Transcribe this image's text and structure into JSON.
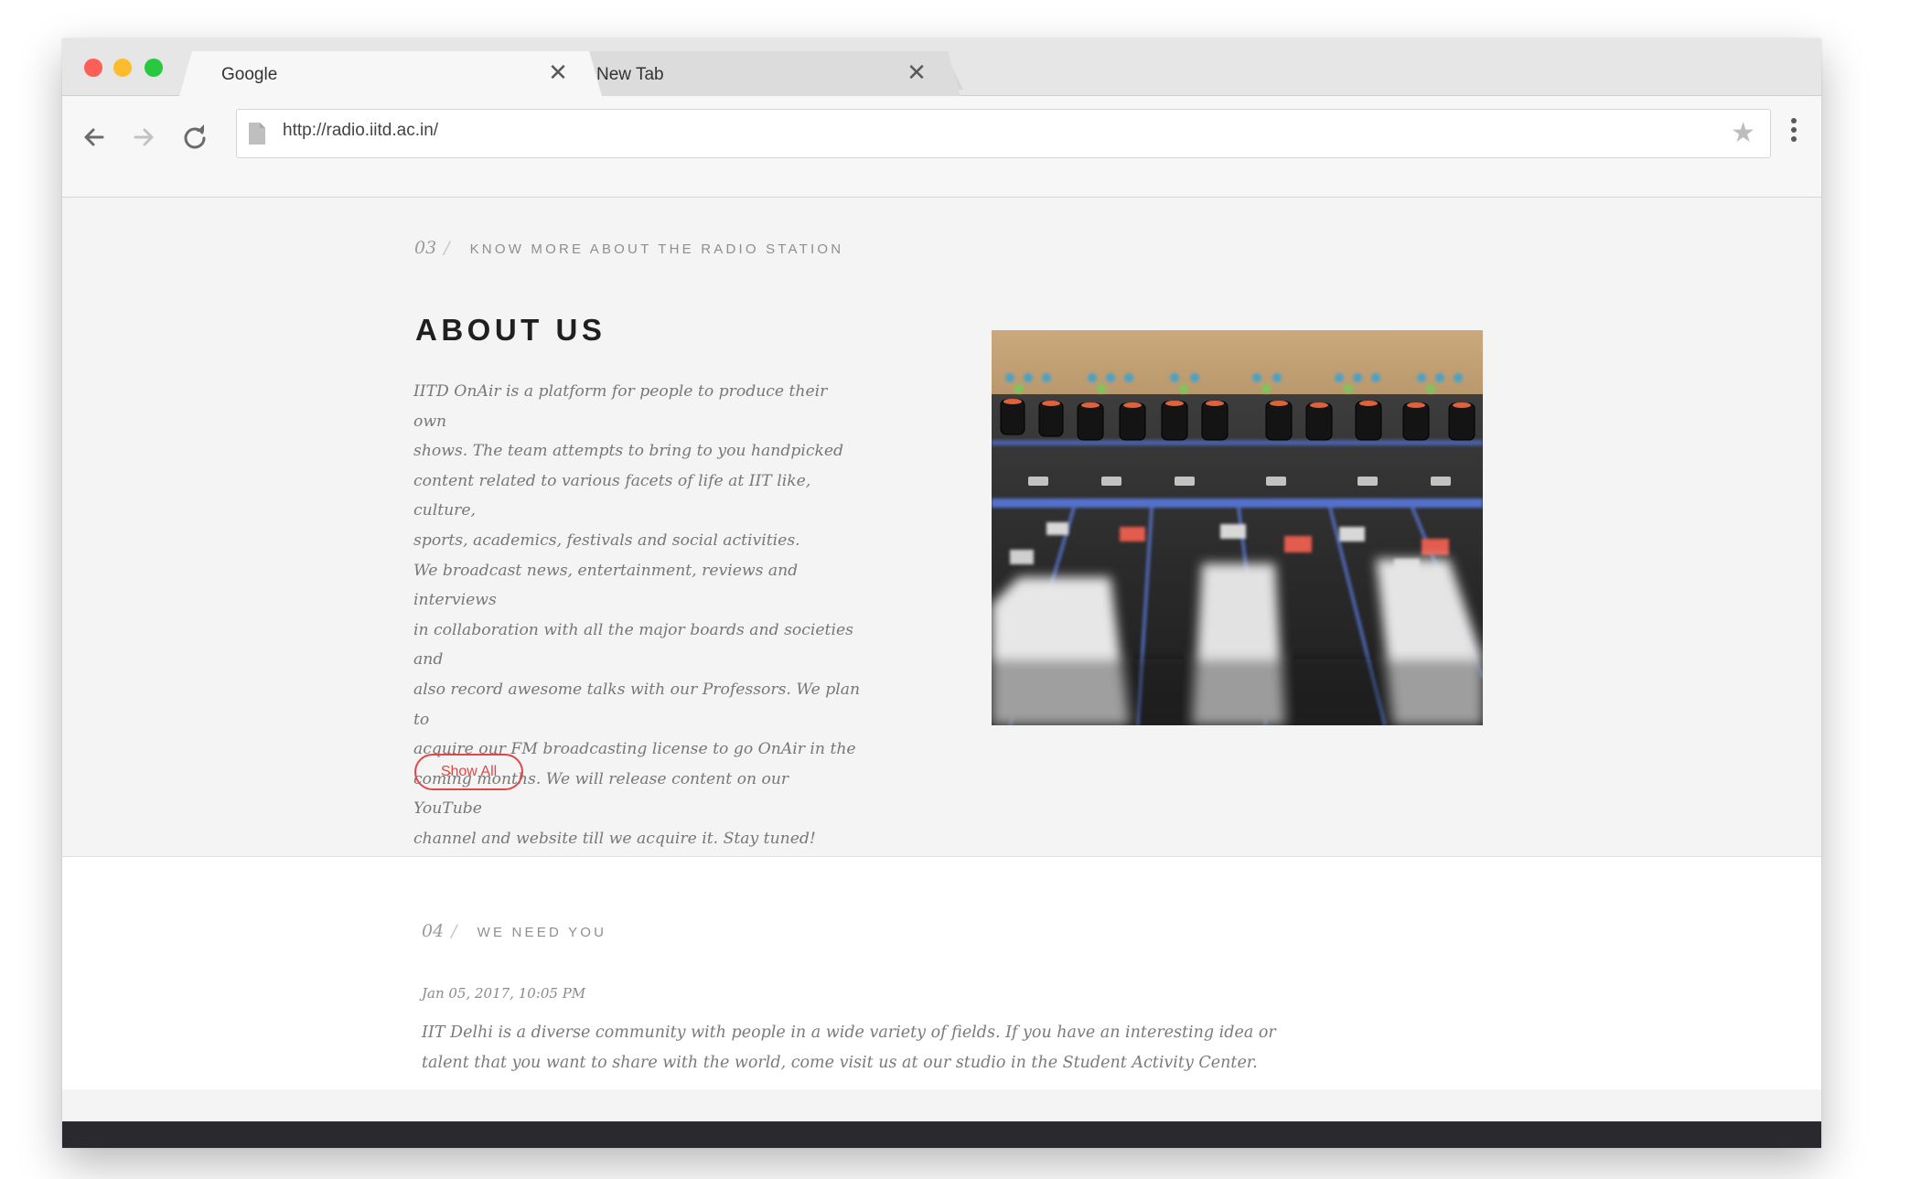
{
  "browser": {
    "tabs": [
      {
        "title": "Google",
        "close": "✕"
      },
      {
        "title": "New Tab",
        "close": "✕"
      }
    ],
    "address": {
      "url": "http://radio.iitd.ac.in/"
    },
    "star": "★",
    "icons": {
      "back": "arrow-left-icon",
      "forward": "arrow-right-icon",
      "reload": "reload-icon",
      "page": "document-icon",
      "bookmark": "star-icon",
      "menu": "more-vertical-icon"
    }
  },
  "about": {
    "section_num": "03",
    "slash": "/",
    "kicker": "KNOW MORE ABOUT THE RADIO STATION",
    "title": "ABOUT US",
    "body": "IITD OnAir is a platform for people to produce their own\nshows. The team attempts to bring to you handpicked\ncontent related to various facets of life at IIT like, culture,\nsports, academics, festivals and social activities.\nWe broadcast news, entertainment, reviews and interviews\nin collaboration with all the major boards and societies and\nalso record awesome talks with our Professors. We plan to\nacquire our FM broadcasting license to go OnAir in the\ncoming months. We will release content on our YouTube\nchannel and website till we acquire it. Stay tuned!",
    "button_label": "Show All"
  },
  "need": {
    "section_num": "04",
    "slash": "/",
    "kicker": "WE NEED YOU",
    "date": "Jan 05, 2017, 10:05 PM",
    "body": "IIT Delhi is a diverse community with people in a wide variety of fields. If you have an interesting idea or talent that you want to share with the world, come visit us at our studio in the Student Activity Center."
  },
  "colors": {
    "accent": "#e04848",
    "footer": "#2a2a2e"
  }
}
